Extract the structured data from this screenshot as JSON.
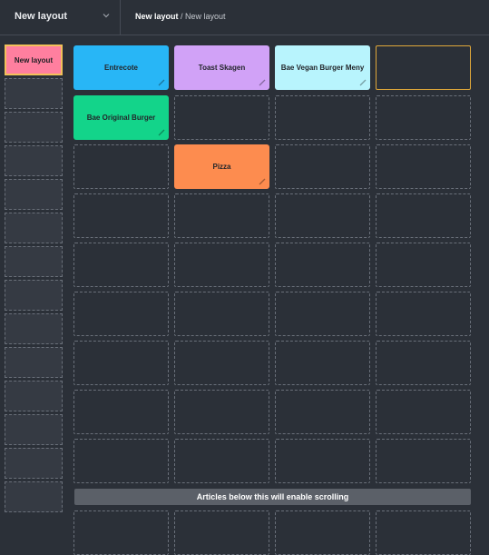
{
  "header": {
    "layout_select": "New layout",
    "breadcrumb_current": "New layout",
    "breadcrumb_sep": " / ",
    "breadcrumb_page": "New layout"
  },
  "sidebar": {
    "active_label": "New layout"
  },
  "tiles": [
    {
      "label": "Entrecote",
      "color": "#28b6f6"
    },
    {
      "label": "Toast Skagen",
      "color": "#d1a2f7"
    },
    {
      "label": "Bae Vegan Burger Meny",
      "color": "#b8f4fd"
    },
    {
      "label": "Bae Original Burger",
      "color": "#13d48a"
    },
    {
      "label": "Pizza",
      "color": "#fd8c4f"
    }
  ],
  "scroll_notice": "Articles below this will enable scrolling"
}
